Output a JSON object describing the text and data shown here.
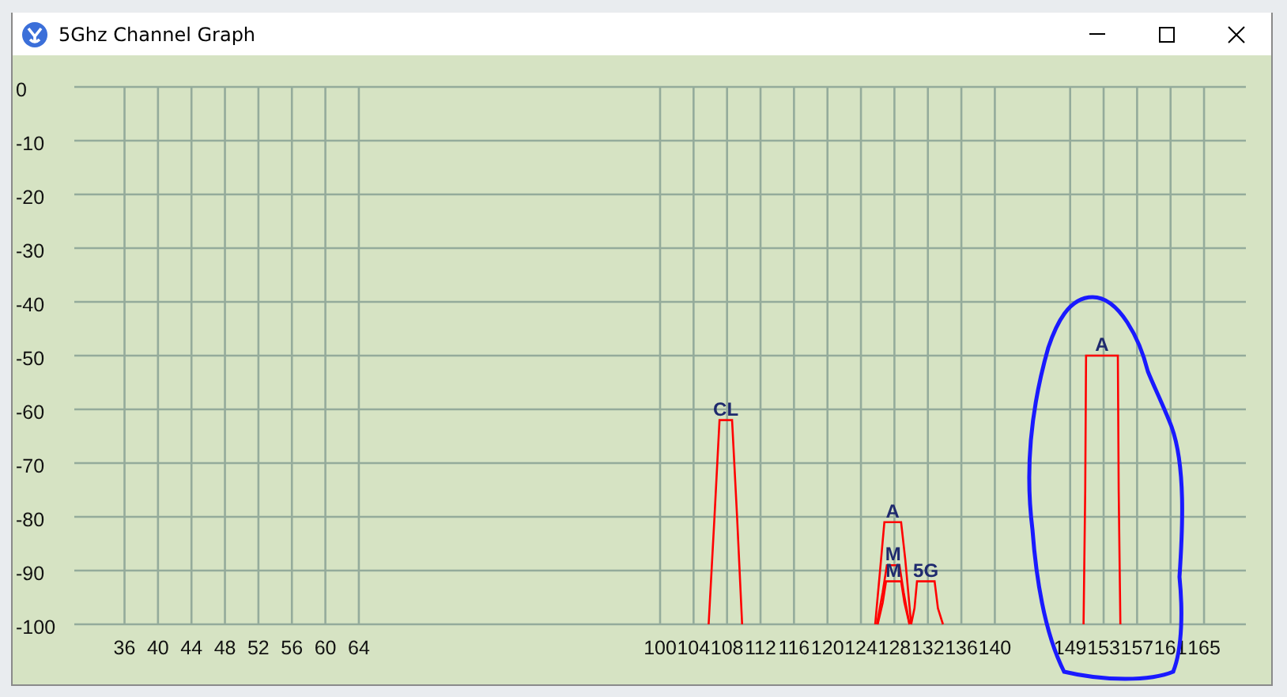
{
  "window": {
    "title": "5Ghz Channel Graph"
  },
  "graph": {
    "chart_data": {
      "type": "line",
      "grid": true,
      "ylim": [
        -100,
        0
      ],
      "xlim": [
        30,
        170
      ],
      "yticks": [
        0,
        -10,
        -20,
        -30,
        -40,
        -50,
        -60,
        -70,
        -80,
        -90,
        -100
      ],
      "xticks": [
        36,
        40,
        44,
        48,
        52,
        56,
        60,
        64,
        100,
        104,
        108,
        112,
        116,
        120,
        124,
        128,
        132,
        136,
        140,
        149,
        153,
        157,
        161,
        165
      ],
      "series": [
        {
          "name": "CL",
          "color": "#ff0000",
          "x": [
            105.8,
            106.5,
            107.1,
            108.6,
            109.2,
            109.8
          ],
          "values": [
            -100,
            -80,
            -62,
            -62,
            -80,
            -100
          ]
        },
        {
          "name": "A",
          "color": "#ff0000",
          "x": [
            125.7,
            126.4,
            126.8,
            128.8,
            129.3,
            130.0
          ],
          "values": [
            -100,
            -88,
            -81,
            -81,
            -88,
            -100
          ]
        },
        {
          "name": "M",
          "color": "#ff0000",
          "x": [
            125.9,
            126.6,
            127.1,
            128.6,
            129.1,
            129.8
          ],
          "values": [
            -100,
            -94,
            -89,
            -89,
            -94,
            -100
          ]
        },
        {
          "name": "M",
          "color": "#ff0000",
          "x": [
            126.0,
            126.6,
            127.0,
            128.8,
            129.2,
            129.8
          ],
          "values": [
            -100,
            -96,
            -92,
            -92,
            -96,
            -100
          ]
        },
        {
          "name": "5G",
          "color": "#ff0000",
          "x": [
            130.0,
            130.4,
            130.7,
            132.8,
            133.2,
            133.8
          ],
          "values": [
            -100,
            -97,
            -92,
            -92,
            -97,
            -100
          ]
        },
        {
          "name": "A",
          "color": "#ff0000",
          "x": [
            150.6,
            150.8,
            150.9,
            154.7,
            154.8,
            155.0
          ],
          "values": [
            -100,
            -75,
            -50,
            -50,
            -75,
            -100
          ]
        }
      ]
    }
  }
}
